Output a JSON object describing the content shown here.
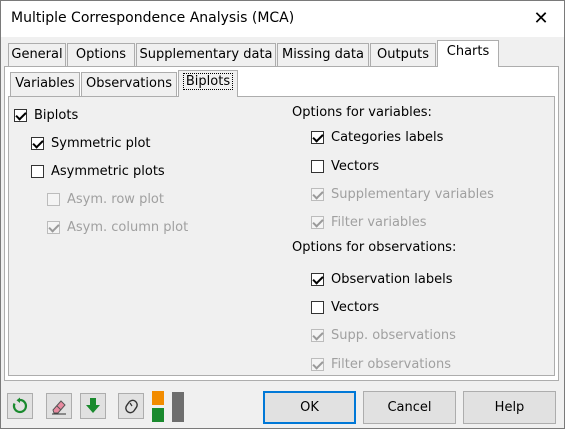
{
  "window": {
    "title": "Multiple Correspondence Analysis (MCA)"
  },
  "tabs": [
    "General",
    "Options",
    "Supplementary data",
    "Missing data",
    "Outputs",
    "Charts"
  ],
  "active_tab": "Charts",
  "subtabs": [
    "Variables",
    "Observations",
    "Biplots"
  ],
  "active_subtab": "Biplots",
  "left": {
    "biplots": {
      "label": "Biplots",
      "checked": true
    },
    "symmetric": {
      "label": "Symmetric plot",
      "checked": true
    },
    "asymmetric": {
      "label": "Asymmetric plots",
      "checked": false
    },
    "asym_row": {
      "label": "Asym. row plot",
      "checked": false,
      "disabled": true
    },
    "asym_col": {
      "label": "Asym. column plot",
      "checked": true,
      "disabled": true
    }
  },
  "variables_options": {
    "heading": "Options for variables:",
    "categories_labels": {
      "label": "Categories labels",
      "checked": true
    },
    "vectors": {
      "label": "Vectors",
      "checked": false
    },
    "supplementary_variables": {
      "label": "Supplementary variables",
      "checked": true,
      "disabled": true
    },
    "filter_variables": {
      "label": "Filter variables",
      "checked": true,
      "disabled": true
    }
  },
  "observations_options": {
    "heading": "Options for observations:",
    "observation_labels": {
      "label": "Observation labels",
      "checked": true
    },
    "vectors": {
      "label": "Vectors",
      "checked": false
    },
    "supp_observations": {
      "label": "Supp. observations",
      "checked": true,
      "disabled": true
    },
    "filter_observations": {
      "label": "Filter observations",
      "checked": true,
      "disabled": true
    }
  },
  "buttons": {
    "ok": "OK",
    "cancel": "Cancel",
    "help": "Help"
  },
  "icons": {
    "reset": "refresh-icon",
    "eraser": "eraser-icon",
    "download": "down-arrow-icon",
    "mouse": "mouse-icon",
    "layout": "layout-toggle-icon"
  },
  "colors": {
    "accent": "#0078d7",
    "green": "#1a8a2e",
    "orange": "#f28c00"
  }
}
